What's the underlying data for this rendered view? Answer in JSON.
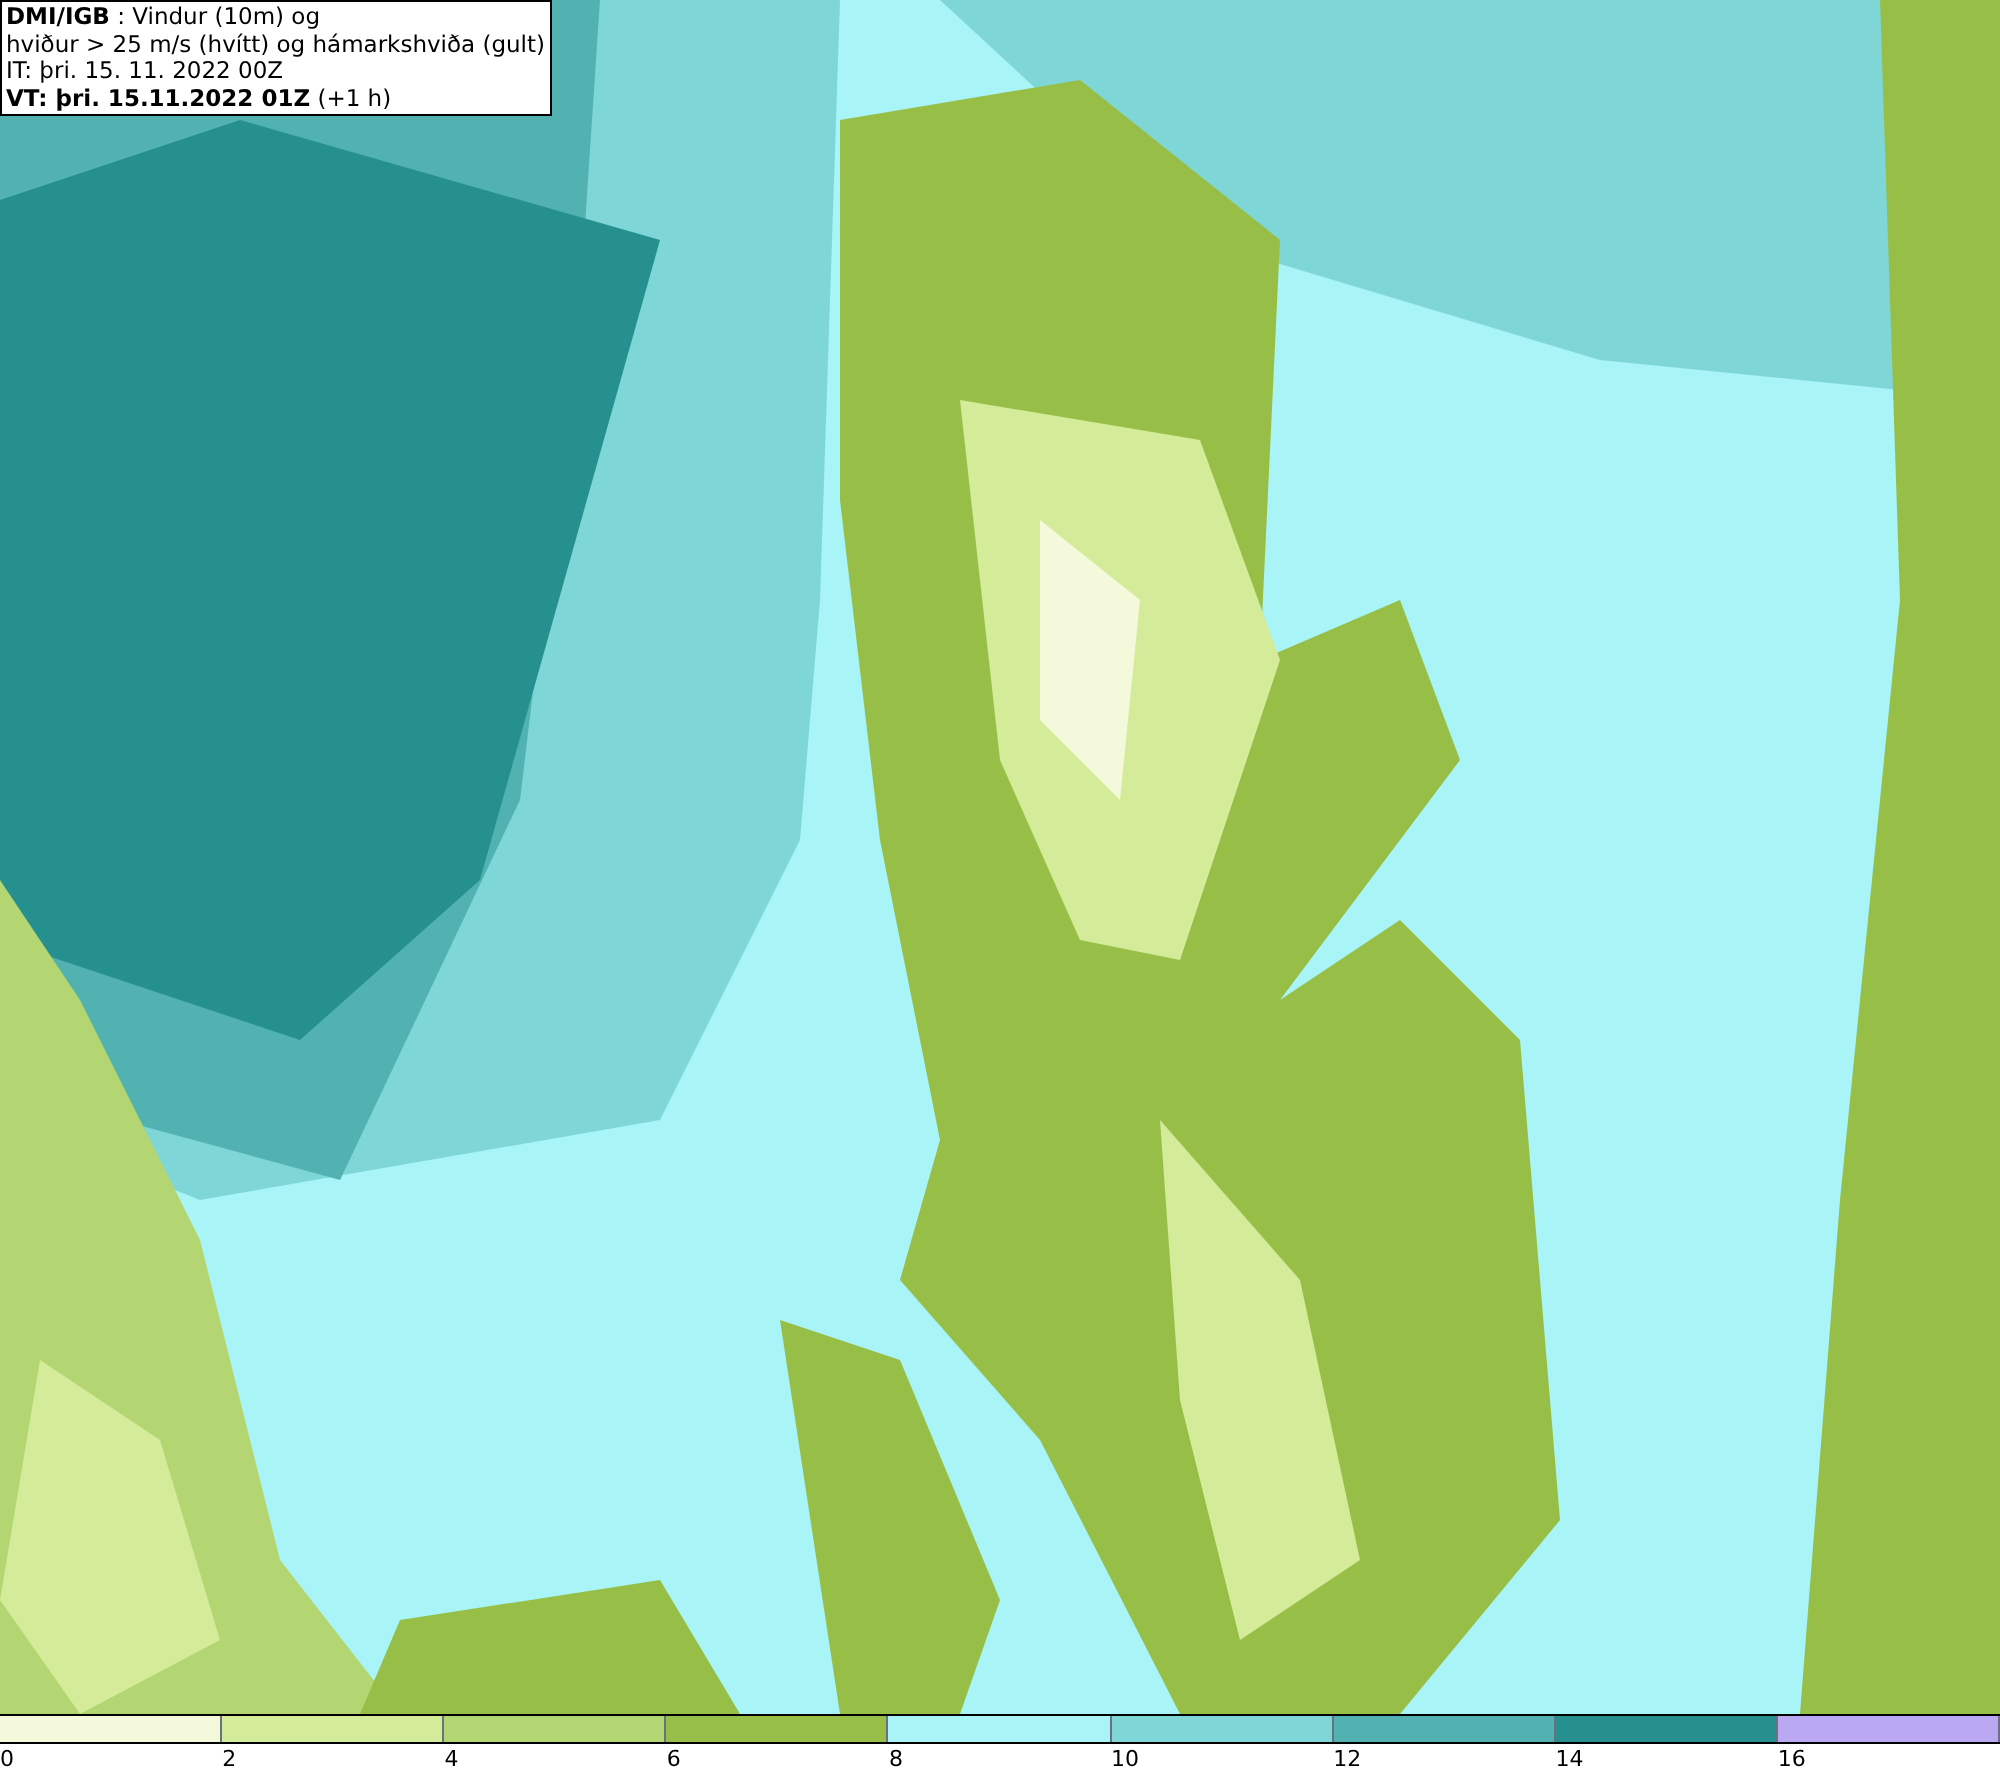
{
  "title_box": {
    "lines": [
      "**DMI/IGB** : Vindur (10m) og",
      "hviður > 25 m/s (hvítt) og hámarkshviða (gult)",
      "IT: þri. 15. 11. 2022 00Z",
      "**VT: þri. 15.11.2022 01Z** (+1 h)"
    ]
  },
  "legend": [
    {
      "color": "#f5f9dc",
      "label": "0"
    },
    {
      "color": "#d4eb9a",
      "label": "2"
    },
    {
      "color": "#b4d672",
      "label": "4"
    },
    {
      "color": "#97bf47",
      "label": "6"
    },
    {
      "color": "#a8f4f6",
      "label": "8"
    },
    {
      "color": "#7fd6d6",
      "label": "10"
    },
    {
      "color": "#52b2b2",
      "label": "12"
    },
    {
      "color": "#26908e",
      "label": "14"
    },
    {
      "color": "#bba8f2",
      "label": "16"
    }
  ]
}
